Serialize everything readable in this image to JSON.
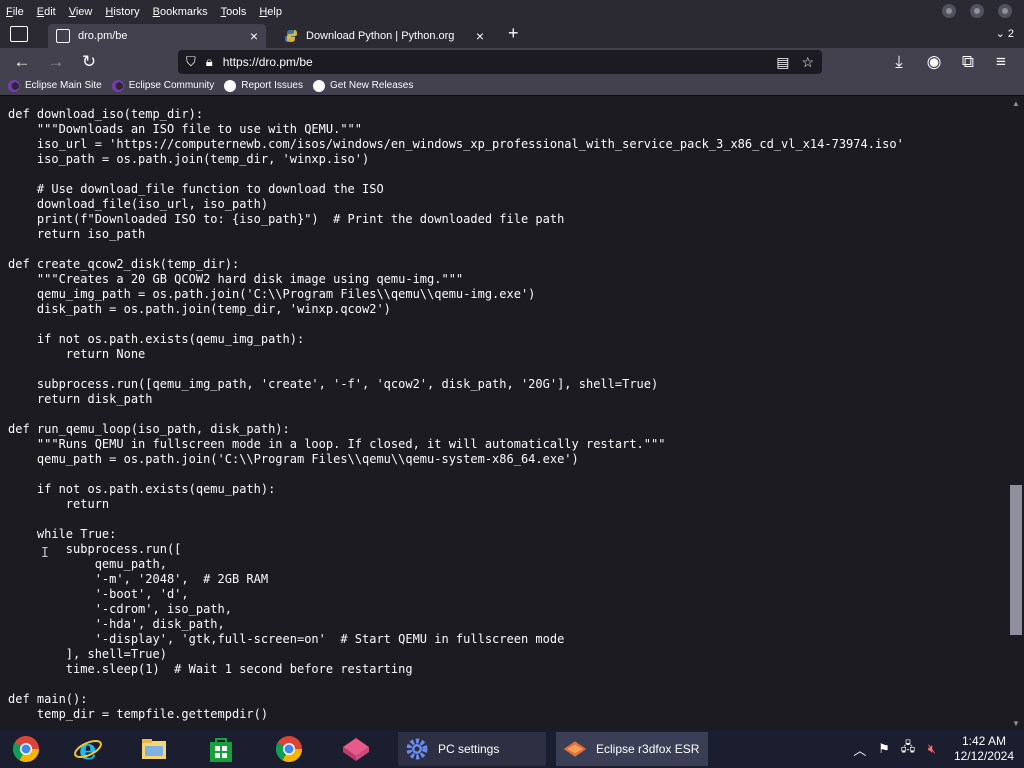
{
  "menu": {
    "items": [
      {
        "label": "File",
        "accel": "F",
        "rest": "ile"
      },
      {
        "label": "Edit",
        "accel": "E",
        "rest": "dit"
      },
      {
        "label": "View",
        "accel": "V",
        "rest": "iew"
      },
      {
        "label": "History",
        "accel": "H",
        "rest": "istory"
      },
      {
        "label": "Bookmarks",
        "accel": "B",
        "rest": "ookmarks"
      },
      {
        "label": "Tools",
        "accel": "T",
        "rest": "ools"
      },
      {
        "label": "Help",
        "accel": "H",
        "rest": "elp"
      }
    ]
  },
  "tabs": [
    {
      "title": "dro.pm/be",
      "active": true
    },
    {
      "title": "Download Python | Python.org",
      "active": false
    }
  ],
  "tab_count": "2",
  "url": "https://dro.pm/be",
  "bookmarks": [
    {
      "label": "Eclipse Main Site",
      "icon": "eclipse-icon"
    },
    {
      "label": "Eclipse Community",
      "icon": "eclipse-icon"
    },
    {
      "label": "Report Issues",
      "icon": "github-icon"
    },
    {
      "label": "Get New Releases",
      "icon": "github-icon"
    }
  ],
  "code_lines": [
    "def download_iso(temp_dir):",
    "    \"\"\"Downloads an ISO file to use with QEMU.\"\"\"",
    "    iso_url = 'https://computernewb.com/isos/windows/en_windows_xp_professional_with_service_pack_3_x86_cd_vl_x14-73974.iso'",
    "    iso_path = os.path.join(temp_dir, 'winxp.iso')",
    "",
    "    # Use download_file function to download the ISO",
    "    download_file(iso_url, iso_path)",
    "    print(f\"Downloaded ISO to: {iso_path}\")  # Print the downloaded file path",
    "    return iso_path",
    "",
    "def create_qcow2_disk(temp_dir):",
    "    \"\"\"Creates a 20 GB QCOW2 hard disk image using qemu-img.\"\"\"",
    "    qemu_img_path = os.path.join('C:\\\\Program Files\\\\qemu\\\\qemu-img.exe')",
    "    disk_path = os.path.join(temp_dir, 'winxp.qcow2')",
    "",
    "    if not os.path.exists(qemu_img_path):",
    "        return None",
    "",
    "    subprocess.run([qemu_img_path, 'create', '-f', 'qcow2', disk_path, '20G'], shell=True)",
    "    return disk_path",
    "",
    "def run_qemu_loop(iso_path, disk_path):",
    "    \"\"\"Runs QEMU in fullscreen mode in a loop. If closed, it will automatically restart.\"\"\"",
    "    qemu_path = os.path.join('C:\\\\Program Files\\\\qemu\\\\qemu-system-x86_64.exe')",
    "",
    "    if not os.path.exists(qemu_path):",
    "        return",
    "",
    "    while True:",
    "        subprocess.run([",
    "            qemu_path,",
    "            '-m', '2048',  # 2GB RAM",
    "            '-boot', 'd',",
    "            '-cdrom', iso_path,",
    "            '-hda', disk_path,",
    "            '-display', 'gtk,full-screen=on'  # Start QEMU in fullscreen mode",
    "        ], shell=True)",
    "        time.sleep(1)  # Wait 1 second before restarting",
    "",
    "def main():",
    "    temp_dir = tempfile.gettempdir()"
  ],
  "taskbar": {
    "pinned": [
      "chrome-icon",
      "internet-explorer-icon",
      "file-explorer-icon",
      "store-icon",
      "google-chrome-icon",
      "app-icon"
    ],
    "pc_settings_label": "PC settings",
    "browser_label": "Eclipse r3dfox ESR"
  },
  "clock": {
    "time": "1:42 AM",
    "date": "12/12/2024"
  },
  "colors": {
    "background": "#1c1b22",
    "toolbar": "#42414d",
    "taskbar": "#1b1e2e"
  }
}
